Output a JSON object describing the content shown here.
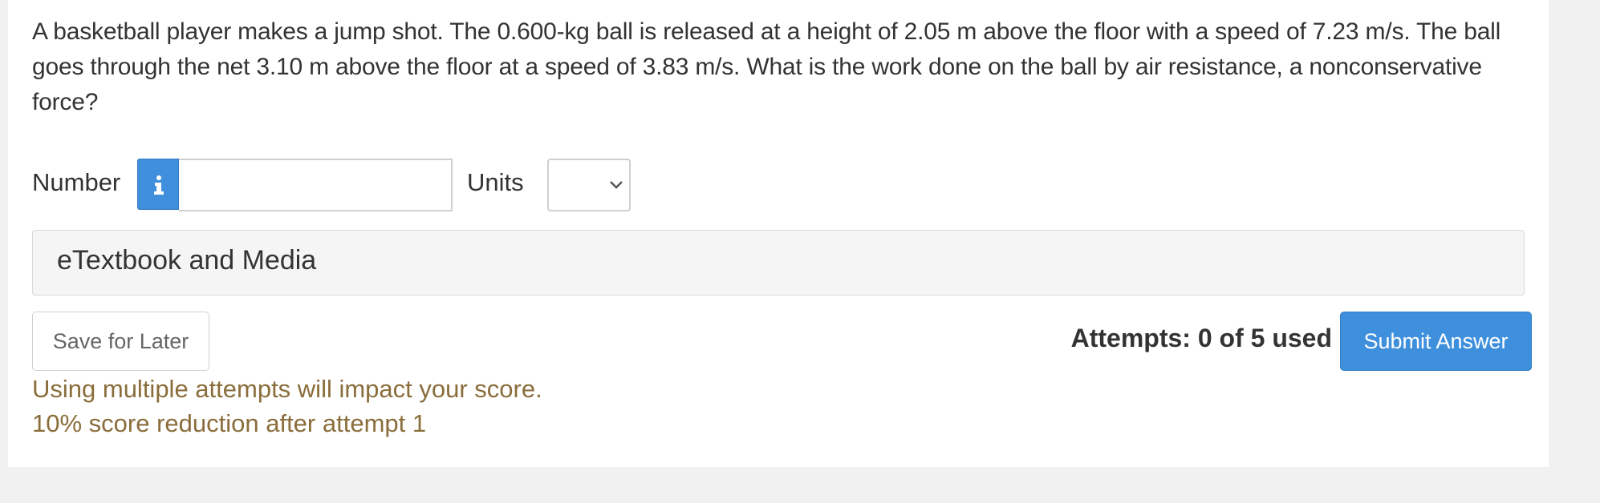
{
  "question": {
    "text": "A basketball player makes a jump shot. The 0.600-kg ball is released at a height of 2.05 m above the floor with a speed of 7.23 m/s. The ball goes through the net 3.10 m above the floor at a speed of 3.83 m/s. What is the work done on the ball by air resistance, a nonconservative force?"
  },
  "answer": {
    "number_label": "Number",
    "number_value": "",
    "units_label": "Units",
    "units_selected": ""
  },
  "resources": {
    "title": "eTextbook and Media"
  },
  "actions": {
    "save_label": "Save for Later",
    "attempts_text": "Attempts: 0 of 5 used",
    "submit_label": "Submit Answer"
  },
  "notices": {
    "line1": "Using multiple attempts will impact your score.",
    "line2": "10% score reduction after attempt 1"
  },
  "colors": {
    "primary_blue": "#3e8fdc",
    "warning_text": "#8a6d3b",
    "panel_bg": "#f5f5f5"
  },
  "icons": {
    "info": "info-icon",
    "dropdown": "chevron-down-icon"
  }
}
